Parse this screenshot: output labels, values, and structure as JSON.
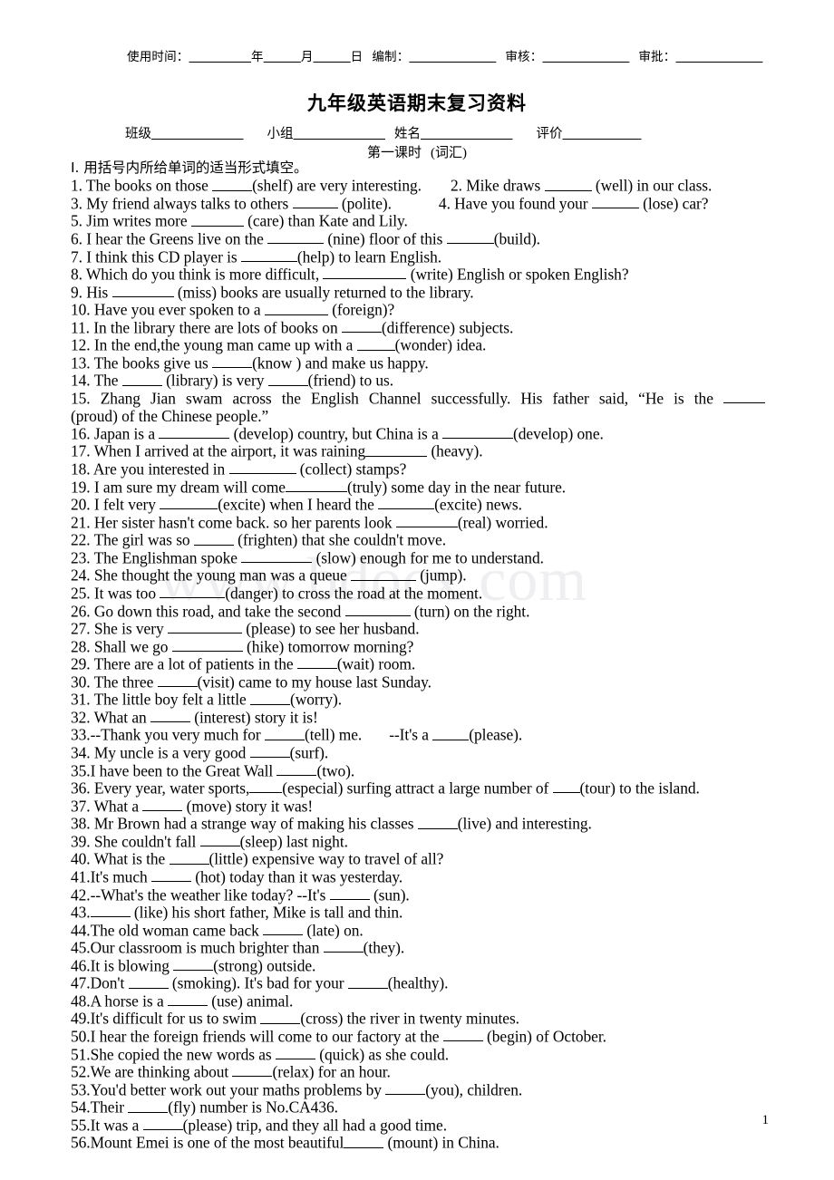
{
  "document": {
    "watermark": "www.bdocx.com",
    "page_number": "1",
    "title": "九年级英语期末复习资料",
    "subtitle_cn": "第一课时",
    "subtitle_en": "(词汇)",
    "section_heading": "I.  用括号内所给单词的适当形式填空。"
  },
  "header": {
    "use_time_label": "使用时间：",
    "year_label": "年",
    "month_label": "月",
    "day_label": "日",
    "compiled_by_label": "编制：",
    "reviewed_by_label": "审核：",
    "approved_by_label": "审批：",
    "blank_use_time": "＿＿＿＿＿",
    "blank_year": "＿＿＿",
    "blank_month": "＿＿＿",
    "blank_compiled": "＿＿＿＿＿＿＿",
    "blank_reviewed": "＿＿＿＿＿＿＿",
    "blank_approved": "＿＿＿＿＿＿＿"
  },
  "info": {
    "class_label": "班级",
    "group_label": "小组",
    "name_label": "姓名",
    "evaluation_label": "评价",
    "class_blank": "＿＿＿＿＿＿＿",
    "group_blank": "＿＿＿＿＿＿＿",
    "name_blank": "＿＿＿＿＿＿＿",
    "evaluation_blank": "＿＿＿＿＿＿"
  },
  "questions": [
    {
      "num": "1.",
      "pre": " The books on those ",
      "blank_w": 44,
      "post": "(shelf) are very interesting."
    },
    {
      "num": "2.",
      "pre": " Mike draws ",
      "blank_w": 52,
      "post": " (well) in our class."
    },
    {
      "num": "3.",
      "pre": " My friend always talks to others ",
      "blank_w": 50,
      "post": " (polite)."
    },
    {
      "num": "4.",
      "pre": " Have you found your ",
      "blank_w": 52,
      "post": " (lose) car?"
    },
    {
      "num": "5.",
      "pre": " Jim writes more ",
      "blank_w": 58,
      "post": " (care) than Kate and Lily."
    },
    {
      "num": "6.",
      "pre": " I hear the Greens live on the ",
      "blank_w": 62,
      "post": " (nine) floor of this ",
      "blank2_w": 52,
      "post2": "(build)."
    },
    {
      "num": "7.",
      "pre": " I think this CD player is ",
      "blank_w": 62,
      "post": "(help) to learn English."
    },
    {
      "num": "8.",
      "pre": " Which do you think is more difficult, ",
      "blank_w": 92,
      "post": " (write) English or spoken English?"
    },
    {
      "num": "9.",
      "pre": " His ",
      "blank_w": 68,
      "post": " (miss) books are usually returned to the library."
    },
    {
      "num": "10.",
      "pre": " Have you ever spoken to a ",
      "blank_w": 70,
      "post": " (foreign)?"
    },
    {
      "num": "11.",
      "pre": " In the library there are lots of books on ",
      "blank_w": 44,
      "post": "(difference) subjects."
    },
    {
      "num": "12.",
      "pre": " In the end,the young man came up with a ",
      "blank_w": 42,
      "post": "(wonder) idea."
    },
    {
      "num": "13.",
      "pre": " The books give us ",
      "blank_w": 44,
      "post": "(know ) and make us happy."
    },
    {
      "num": "14.",
      "pre": " The ",
      "blank_w": 44,
      "post": " (library) is very ",
      "blank2_w": 44,
      "post2": "(friend) to us."
    },
    {
      "num": "15.",
      "line1": "15. Zhang Jian swam across the English Channel successfully. His father said, “He is the ",
      "line1_blank_w": 46,
      "line2_pre": "(proud) of the Chinese people.”"
    },
    {
      "num": "16.",
      "pre": " Japan is a ",
      "blank_w": 78,
      "post": " (develop) country, but China is a ",
      "blank2_w": 78,
      "post2": "(develop) one."
    },
    {
      "num": "17.",
      "pre": " When I arrived at the airport, it was raining",
      "blank_w": 68,
      "post": " (heavy)."
    },
    {
      "num": "18.",
      "pre": " Are you interested in ",
      "blank_w": 74,
      "post": " (collect) stamps?"
    },
    {
      "num": "19.",
      "pre": " I am sure my dream will come",
      "blank_w": 68,
      "post": "(truly) some day in the near future."
    },
    {
      "num": "20.",
      "pre": " I felt very ",
      "blank_w": 64,
      "post": "(excite) when I heard the ",
      "blank2_w": 62,
      "post2": "(excite) news."
    },
    {
      "num": "21.",
      "pre": " Her sister hasn't come back. so her parents look ",
      "blank_w": 68,
      "post": "(real) worried."
    },
    {
      "num": "22.",
      "pre": " The girl was so ",
      "blank_w": 44,
      "post": " (frighten) that she couldn't move."
    },
    {
      "num": "23.",
      "pre": " The Englishman spoke ",
      "blank_w": 78,
      "post": " (slow) enough for me to understand."
    },
    {
      "num": "24.",
      "pre": " She thought the young man was a queue ",
      "blank_w": 72,
      "post": " (jump)."
    },
    {
      "num": "25.",
      "pre": " It was too ",
      "blank_w": 72,
      "post": "(danger) to cross the road at the moment."
    },
    {
      "num": "26.",
      "pre": " Go down this road, and take the second ",
      "blank_w": 72,
      "post": " (turn) on the right."
    },
    {
      "num": "27.",
      "pre": " She is very ",
      "blank_w": 82,
      "post": " (please) to see her husband."
    },
    {
      "num": "28.",
      "pre": " Shall we go ",
      "blank_w": 78,
      "post": " (hike) tomorrow morning?"
    },
    {
      "num": "29.",
      "pre": " There are a lot of patients in the ",
      "blank_w": 44,
      "post": "(wait) room."
    },
    {
      "num": "30.",
      "pre": " The three ",
      "blank_w": 44,
      "post": "(visit) came to my house last Sunday."
    },
    {
      "num": "31.",
      "pre": " The little boy felt a little ",
      "blank_w": 44,
      "post": "(worry)."
    },
    {
      "num": "32.",
      "pre": " What an ",
      "blank_w": 44,
      "post": " (interest) story it is!"
    },
    {
      "num": "33.",
      "pre": "--Thank you very much for ",
      "blank_w": 44,
      "post": "(tell) me.",
      "gap": 30,
      "post_extra": "--It's a ",
      "blank2_w": 40,
      "post2": "(please)."
    },
    {
      "num": "34.",
      "pre": " My uncle is a very good ",
      "blank_w": 44,
      "post": "(surf)."
    },
    {
      "num": "35.",
      "pre": "I have been to the Great Wall ",
      "blank_w": 44,
      "post": "(two)."
    },
    {
      "num": "36.",
      "pre": " Every year, water sports,",
      "blank_w": 36,
      "post": "(especial) surfing attract a large number of ",
      "blank2_w": 30,
      "post2": "(tour) to the island."
    },
    {
      "num": "37.",
      "pre": " What a ",
      "blank_w": 44,
      "post": " (move) story it was!"
    },
    {
      "num": "38.",
      "pre": " Mr Brown had a strange way of making his classes ",
      "blank_w": 44,
      "post": "(live) and interesting."
    },
    {
      "num": "39.",
      "pre": " She couldn't fall ",
      "blank_w": 44,
      "post": "(sleep) last night."
    },
    {
      "num": "40.",
      "pre": " What is the ",
      "blank_w": 44,
      "post": "(little) expensive way to travel of all?"
    },
    {
      "num": "41.",
      "pre": "It's much ",
      "blank_w": 44,
      "post": " (hot) today than it was yesterday."
    },
    {
      "num": "42.",
      "pre": "--What's the weather like today? --It's ",
      "blank_w": 44,
      "post": " (sun)."
    },
    {
      "num": "43.",
      "pre": "",
      "blank_w": 44,
      "post": " (like) his short father, Mike is tall and thin."
    },
    {
      "num": "44.",
      "pre": "The old woman came back ",
      "blank_w": 44,
      "post": " (late) on."
    },
    {
      "num": "45.",
      "pre": "Our classroom is much brighter   than ",
      "blank_w": 44,
      "post": "(they)."
    },
    {
      "num": "46.",
      "pre": "It is blowing ",
      "blank_w": 44,
      "post": "(strong) outside."
    },
    {
      "num": "47.",
      "pre": "Don't ",
      "blank_w": 44,
      "post": " (smoking). It's bad for your ",
      "blank2_w": 44,
      "post2": "(healthy)."
    },
    {
      "num": "48.",
      "pre": "A horse is a ",
      "blank_w": 44,
      "post": " (use) animal."
    },
    {
      "num": "49.",
      "pre": "It's difficult for us to swim ",
      "blank_w": 44,
      "post": "(cross) the river in twenty minutes."
    },
    {
      "num": "50.",
      "pre": "I hear the foreign friends will come to our factory at the ",
      "blank_w": 44,
      "post": " (begin) of October."
    },
    {
      "num": "51.",
      "pre": "She copied the new words as ",
      "blank_w": 44,
      "post": " (quick) as she could."
    },
    {
      "num": "52.",
      "pre": "We are thinking about ",
      "blank_w": 44,
      "post": "(relax) for an hour."
    },
    {
      "num": "53.",
      "pre": "You'd better work out your maths problems by ",
      "blank_w": 44,
      "post": "(you), children."
    },
    {
      "num": "54.",
      "pre": "Their ",
      "blank_w": 44,
      "post": "(fly) number is No.CA436."
    },
    {
      "num": "55.",
      "pre": "It was a ",
      "blank_w": 44,
      "post": "(please) trip, and they all had a good time."
    },
    {
      "num": "56.",
      "pre": "Mount Emei is one of the most beautiful",
      "blank_w": 44,
      "post": " (mount) in China."
    }
  ],
  "line_groups": [
    {
      "items": [
        0,
        1
      ],
      "gap": 30
    },
    {
      "items": [
        2,
        3
      ],
      "gap": 48
    },
    {
      "items": [
        4
      ]
    },
    {
      "items": [
        5
      ]
    },
    {
      "items": [
        6
      ]
    },
    {
      "items": [
        7
      ]
    },
    {
      "items": [
        8
      ]
    },
    {
      "items": [
        9
      ]
    },
    {
      "items": [
        10
      ]
    },
    {
      "items": [
        11
      ]
    },
    {
      "items": [
        12
      ]
    },
    {
      "items": [
        13
      ]
    }
  ]
}
